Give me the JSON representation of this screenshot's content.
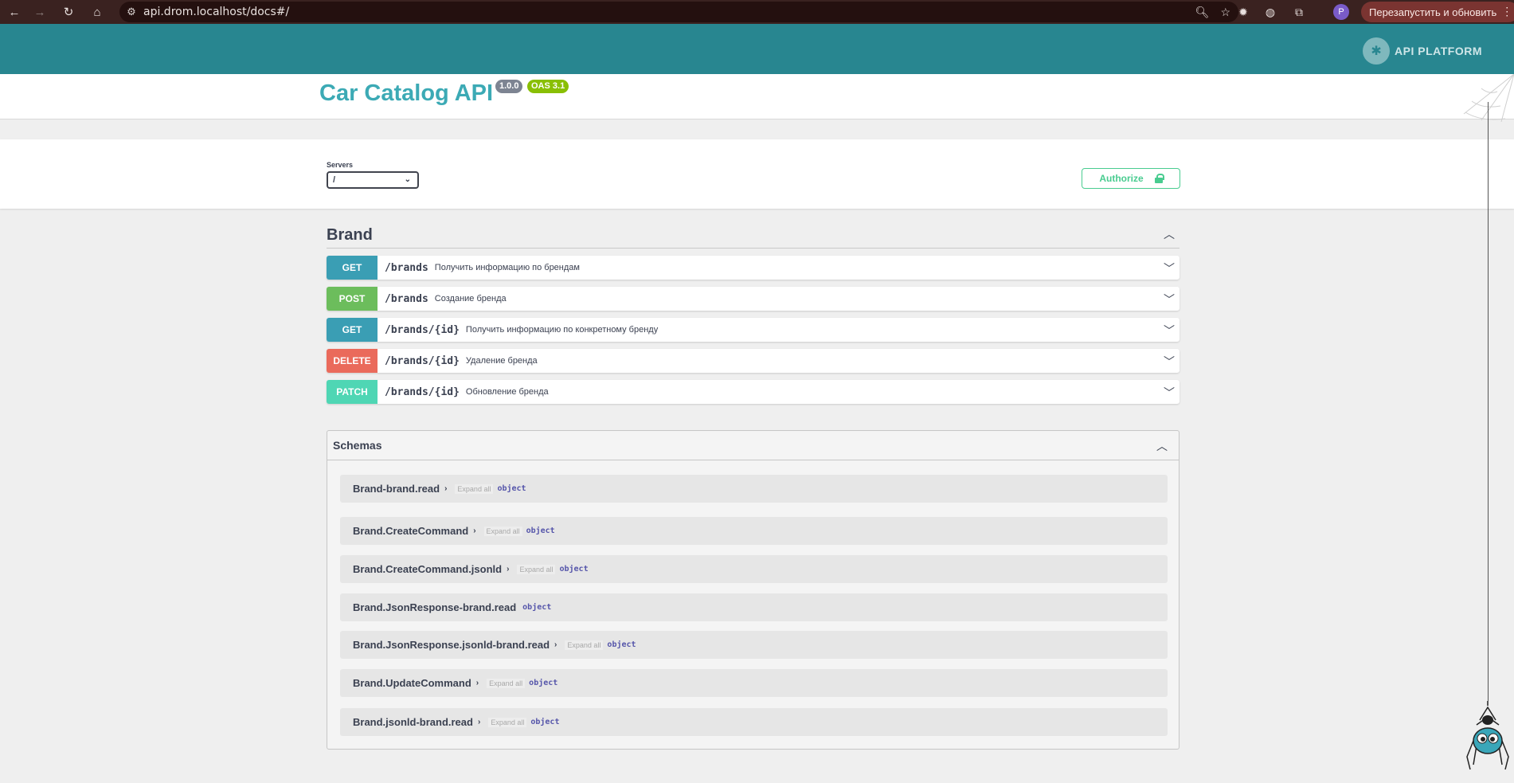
{
  "browser": {
    "url": "api.drom.localhost/docs#/",
    "restart_label": "Перезапустить и обновить",
    "avatar_letter": "P"
  },
  "logo": {
    "text": "API PLATFORM"
  },
  "info": {
    "title": "Car Catalog API",
    "version": "1.0.0",
    "oas": "OAS 3.1"
  },
  "servers": {
    "label": "Servers",
    "selected": "/"
  },
  "authorize_label": "Authorize",
  "tag": {
    "name": "Brand",
    "operations": [
      {
        "method": "GET",
        "path": "/brands",
        "summary": "Получить информацию по брендам",
        "color": "#3a9eb4"
      },
      {
        "method": "POST",
        "path": "/brands",
        "summary": "Создание бренда",
        "color": "#6cbd5c"
      },
      {
        "method": "GET",
        "path": "/brands/{id}",
        "summary": "Получить информацию по конкретному бренду",
        "color": "#3a9eb4"
      },
      {
        "method": "DELETE",
        "path": "/brands/{id}",
        "summary": "Удаление бренда",
        "color": "#ea6a5b"
      },
      {
        "method": "PATCH",
        "path": "/brands/{id}",
        "summary": "Обновление бренда",
        "color": "#4fd6b4"
      }
    ]
  },
  "schemas": {
    "title": "Schemas",
    "models": [
      {
        "name": "Brand-brand.read",
        "expand": "Expand all",
        "type": "object"
      },
      {
        "name": "Brand.CreateCommand",
        "expand": "Expand all",
        "type": "object"
      },
      {
        "name": "Brand.CreateCommand.jsonld",
        "expand": "Expand all",
        "type": "object"
      },
      {
        "name": "Brand.JsonResponse-brand.read",
        "expand": "",
        "type": "object"
      },
      {
        "name": "Brand.JsonResponse.jsonld-brand.read",
        "expand": "Expand all",
        "type": "object"
      },
      {
        "name": "Brand.UpdateCommand",
        "expand": "Expand all",
        "type": "object"
      },
      {
        "name": "Brand.jsonld-brand.read",
        "expand": "Expand all",
        "type": "object"
      }
    ]
  }
}
